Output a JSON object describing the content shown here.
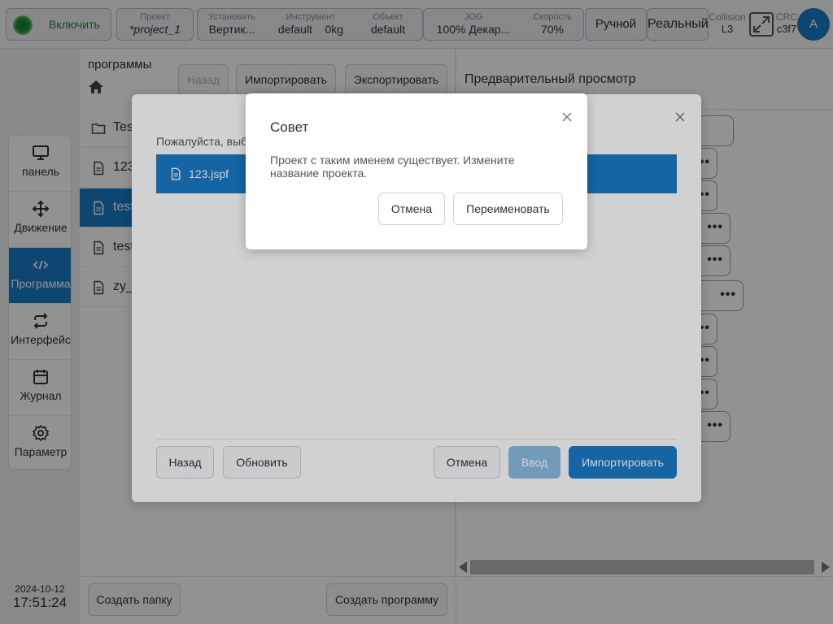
{
  "topbar": {
    "enable_label": "Включить",
    "project": {
      "caption": "Проект",
      "value": "*project_1"
    },
    "install": {
      "caption": "Установить",
      "value": "Вертик..."
    },
    "tool": {
      "caption": "Инструмент",
      "value": "default",
      "value2": "0kg"
    },
    "object": {
      "caption": "Объект",
      "value": "default"
    },
    "jog": {
      "caption": "JOG",
      "value": "100%  Декар..."
    },
    "speed": {
      "caption": "Скорость",
      "value": "70%"
    },
    "mode_manual": "Ручной",
    "mode_real": "Реальный",
    "collision": {
      "caption": "Collision",
      "value": "L3"
    },
    "crc": {
      "caption": "CRC",
      "value": "c3f7"
    },
    "avatar": "A",
    "enable_led_color": "#1f8f3c",
    "accent_color": "#1a7bc8"
  },
  "nav": {
    "items": [
      {
        "label": "панель",
        "icon": "monitor-icon"
      },
      {
        "label": "Движение",
        "icon": "move-arrows-icon"
      },
      {
        "label": "Программа",
        "icon": "code-icon",
        "active": true
      },
      {
        "label": "Интерфейс",
        "icon": "repeat-icon"
      },
      {
        "label": "Журнал",
        "icon": "calendar-icon"
      },
      {
        "label": "Параметр",
        "icon": "gear-icon"
      }
    ]
  },
  "datetime": {
    "date": "2024-10-12",
    "time": "17:51:24"
  },
  "programs": {
    "title": "программы",
    "back_label": "Назад",
    "import_label": "Импортировать",
    "export_label": "Экспортировать",
    "files": [
      {
        "name": "Tes",
        "type": "folder"
      },
      {
        "name": "123",
        "type": "file"
      },
      {
        "name": "test",
        "type": "file",
        "selected": true
      },
      {
        "name": "test",
        "type": "file"
      },
      {
        "name": "zy_",
        "type": "file"
      }
    ],
    "create_folder_label": "Создать папку",
    "create_program_label": "Создать программу"
  },
  "preview": {
    "title": "Предварительный просмотр",
    "node_menu": "•••"
  },
  "import_dialog": {
    "hint": "Пожалуйста, выб",
    "file_name": "123.jspf",
    "back_label": "Назад",
    "refresh_label": "Обновить",
    "cancel_label": "Отмена",
    "enter_label": "Ввод",
    "import_label": "Импортировать"
  },
  "tip_dialog": {
    "title": "Совет",
    "message": "Проект с таким именем существует. Измените название проекта.",
    "cancel_label": "Отмена",
    "rename_label": "Переименовать"
  }
}
